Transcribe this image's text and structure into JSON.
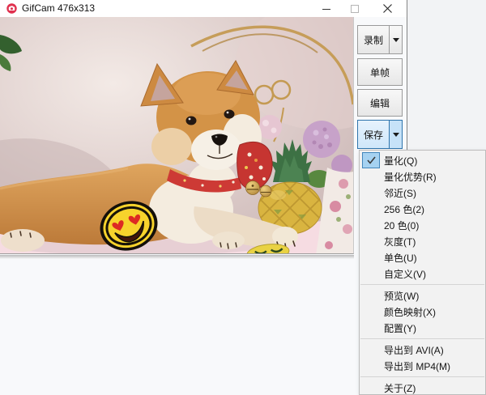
{
  "window": {
    "title": "GifCam 476x313",
    "app_icon": "gifcam-logo-red-circle-camera",
    "controls": [
      "minimize-icon",
      "maximize-icon",
      "close-icon"
    ]
  },
  "toolbar": {
    "record_label": "录制",
    "frame_label": "单帧",
    "edit_label": "编辑",
    "save_label": "保存",
    "dropdown_icon": "chevron-down-icon"
  },
  "menu": {
    "checked_icon": "checkmark-icon",
    "groups": [
      {
        "items": [
          {
            "label": "量化(Q)",
            "checked": true
          },
          {
            "label": "量化优势(R)"
          },
          {
            "label": "邻近(S)"
          },
          {
            "label": "256 色(2)"
          },
          {
            "label": "20 色(0)"
          },
          {
            "label": "灰度(T)"
          },
          {
            "label": "单色(U)"
          },
          {
            "label": "自定义(V)"
          }
        ]
      },
      {
        "items": [
          {
            "label": "预览(W)"
          },
          {
            "label": "颜色映射(X)"
          },
          {
            "label": "配置(Y)"
          }
        ]
      },
      {
        "items": [
          {
            "label": "导出到 AVI(A)"
          },
          {
            "label": "导出到 MP4(M)"
          }
        ]
      },
      {
        "items": [
          {
            "label": "关于(Z)"
          }
        ]
      }
    ]
  },
  "photo": {
    "description": "Shiba Inu puppy lying on pink blanket with red floral bandana and bells, heart-eyes emoji sticker, decorative pineapple and purple flowers"
  },
  "colors": {
    "accent_blue": "#2f75ad",
    "check_bg": "#a6d2f1",
    "menu_bg": "#f2f2f2",
    "titlebar_bg": "#ffffff",
    "app_icon_red": "#e0304e"
  }
}
